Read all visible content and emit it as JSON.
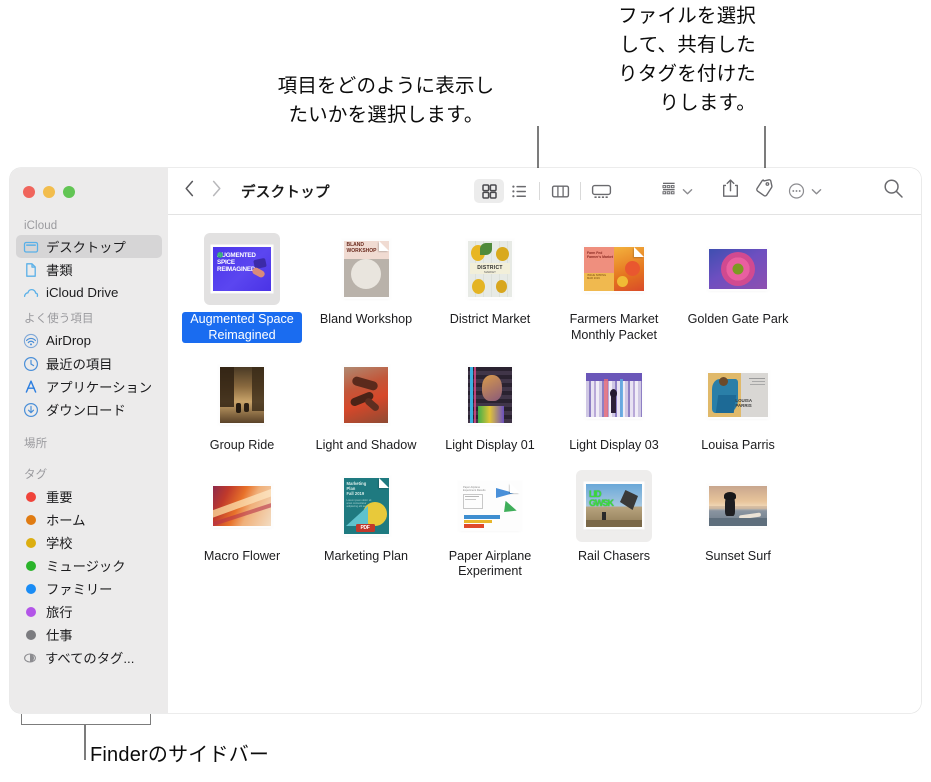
{
  "callouts": {
    "view_options": "項目をどのように表示し\nたいかを選択します。",
    "share_tag": "ファイルを選択\nして、共有した\nりタグを付けた\nりします。",
    "sidebar": "Finderのサイドバー"
  },
  "window": {
    "traffic_lights": [
      "close",
      "minimize",
      "maximize"
    ],
    "title": "デスクトップ"
  },
  "toolbar": {
    "back_label": "‹",
    "forward_label": "›",
    "view_icon_grid": "grid-view-icon",
    "view_icon_list": "list-view-icon",
    "view_icon_column": "column-view-icon",
    "view_icon_gallery": "gallery-view-icon",
    "arrange_icon": "group-items-icon",
    "share_icon": "share-icon",
    "tag_icon": "tag-icon",
    "more_icon": "more-actions-icon",
    "search_icon": "search-icon",
    "active_view": "grid"
  },
  "sidebar": {
    "sections": [
      {
        "header": "iCloud",
        "items": [
          {
            "label": "デスクトップ",
            "icon": "desktop-icon",
            "selected": true
          },
          {
            "label": "書類",
            "icon": "document-icon",
            "selected": false
          },
          {
            "label": "iCloud Drive",
            "icon": "cloud-icon",
            "selected": false
          }
        ]
      },
      {
        "header": "よく使う項目",
        "items": [
          {
            "label": "AirDrop",
            "icon": "airdrop-icon",
            "selected": false
          },
          {
            "label": "最近の項目",
            "icon": "clock-icon",
            "selected": false
          },
          {
            "label": "アプリケーション",
            "icon": "applications-icon",
            "selected": false
          },
          {
            "label": "ダウンロード",
            "icon": "downloads-icon",
            "selected": false
          }
        ]
      },
      {
        "header": "場所",
        "items": []
      },
      {
        "header": "タグ",
        "items": [
          {
            "label": "重要",
            "icon": "tag-dot",
            "color": "#f0433a",
            "selected": false
          },
          {
            "label": "ホーム",
            "icon": "tag-dot",
            "color": "#e07b12",
            "selected": false
          },
          {
            "label": "学校",
            "icon": "tag-dot",
            "color": "#dcae10",
            "selected": false
          },
          {
            "label": "ミュージック",
            "icon": "tag-dot",
            "color": "#2bb42b",
            "selected": false
          },
          {
            "label": "ファミリー",
            "icon": "tag-dot",
            "color": "#1a8cf5",
            "selected": false
          },
          {
            "label": "旅行",
            "icon": "tag-dot",
            "color": "#b355e8",
            "selected": false
          },
          {
            "label": "仕事",
            "icon": "tag-dot",
            "color": "#7c7c80",
            "selected": false
          },
          {
            "label": "すべてのタグ...",
            "icon": "all-tags-icon",
            "selected": false
          }
        ]
      }
    ]
  },
  "files": [
    {
      "name": "Augmented Space Reimagined",
      "kind": "image",
      "selected": true
    },
    {
      "name": "Bland Workshop",
      "kind": "document",
      "selected": false
    },
    {
      "name": "District Market",
      "kind": "image",
      "selected": false
    },
    {
      "name": "Farmers Market Monthly Packet",
      "kind": "document",
      "selected": false
    },
    {
      "name": "Golden Gate Park",
      "kind": "image",
      "selected": false
    },
    {
      "name": "Group Ride",
      "kind": "image",
      "selected": false
    },
    {
      "name": "Light and Shadow",
      "kind": "image",
      "selected": false
    },
    {
      "name": "Light Display 01",
      "kind": "image",
      "selected": false
    },
    {
      "name": "Light Display 03",
      "kind": "image",
      "selected": false
    },
    {
      "name": "Louisa Parris",
      "kind": "image",
      "selected": false
    },
    {
      "name": "Macro Flower",
      "kind": "image",
      "selected": false
    },
    {
      "name": "Marketing Plan",
      "kind": "pdf",
      "selected": false
    },
    {
      "name": "Paper Airplane Experiment",
      "kind": "document",
      "selected": false
    },
    {
      "name": "Rail Chasers",
      "kind": "image",
      "selected": false
    },
    {
      "name": "Sunset Surf",
      "kind": "image",
      "selected": false
    }
  ],
  "colors": {
    "selection_blue": "#1a6cf0",
    "sidebar_bg": "#ecebeb",
    "sidebar_selected": "#d6d5d6",
    "callout_line": "#7c7c7c"
  }
}
